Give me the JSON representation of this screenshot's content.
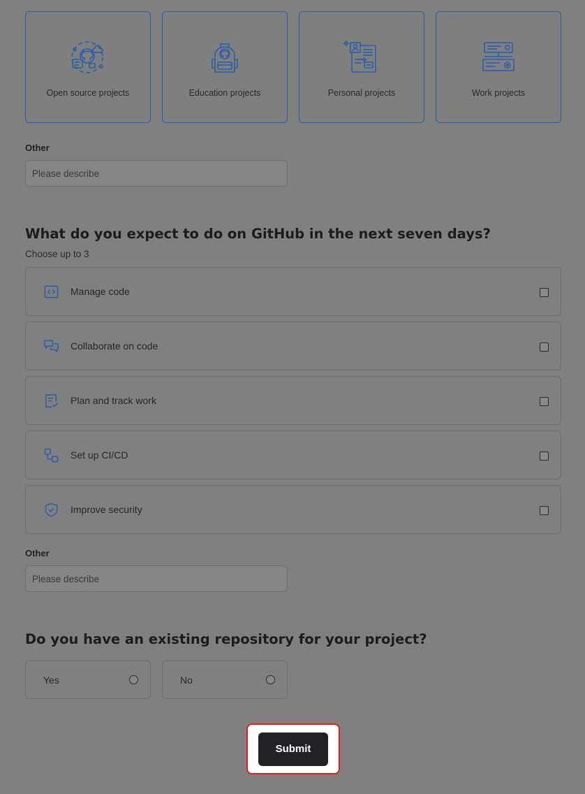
{
  "project_types": [
    {
      "label": "Open source projects",
      "icon": "open-source-icon"
    },
    {
      "label": "Education projects",
      "icon": "backpack-icon"
    },
    {
      "label": "Personal projects",
      "icon": "profile-page-icon"
    },
    {
      "label": "Work projects",
      "icon": "server-icon"
    }
  ],
  "other_1": {
    "label": "Other",
    "placeholder": "Please describe"
  },
  "question_2": {
    "title": "What do you expect to do on GitHub in the next seven days?",
    "hint": "Choose up to 3",
    "options": [
      {
        "label": "Manage code",
        "icon": "code-icon",
        "checked": false
      },
      {
        "label": "Collaborate on code",
        "icon": "comment-discussion-icon",
        "checked": false
      },
      {
        "label": "Plan and track work",
        "icon": "checklist-icon",
        "checked": false
      },
      {
        "label": "Set up CI/CD",
        "icon": "workflow-icon",
        "checked": false
      },
      {
        "label": "Improve security",
        "icon": "shield-check-icon",
        "checked": false
      }
    ]
  },
  "other_2": {
    "label": "Other",
    "placeholder": "Please describe"
  },
  "question_3": {
    "title": "Do you have an existing repository for your project?",
    "options": [
      {
        "label": "Yes",
        "selected": false
      },
      {
        "label": "No",
        "selected": false
      }
    ]
  },
  "submit": {
    "label": "Submit"
  },
  "colors": {
    "accent": "#2f5eaa",
    "highlight": "#e02020",
    "button": "#212226"
  }
}
